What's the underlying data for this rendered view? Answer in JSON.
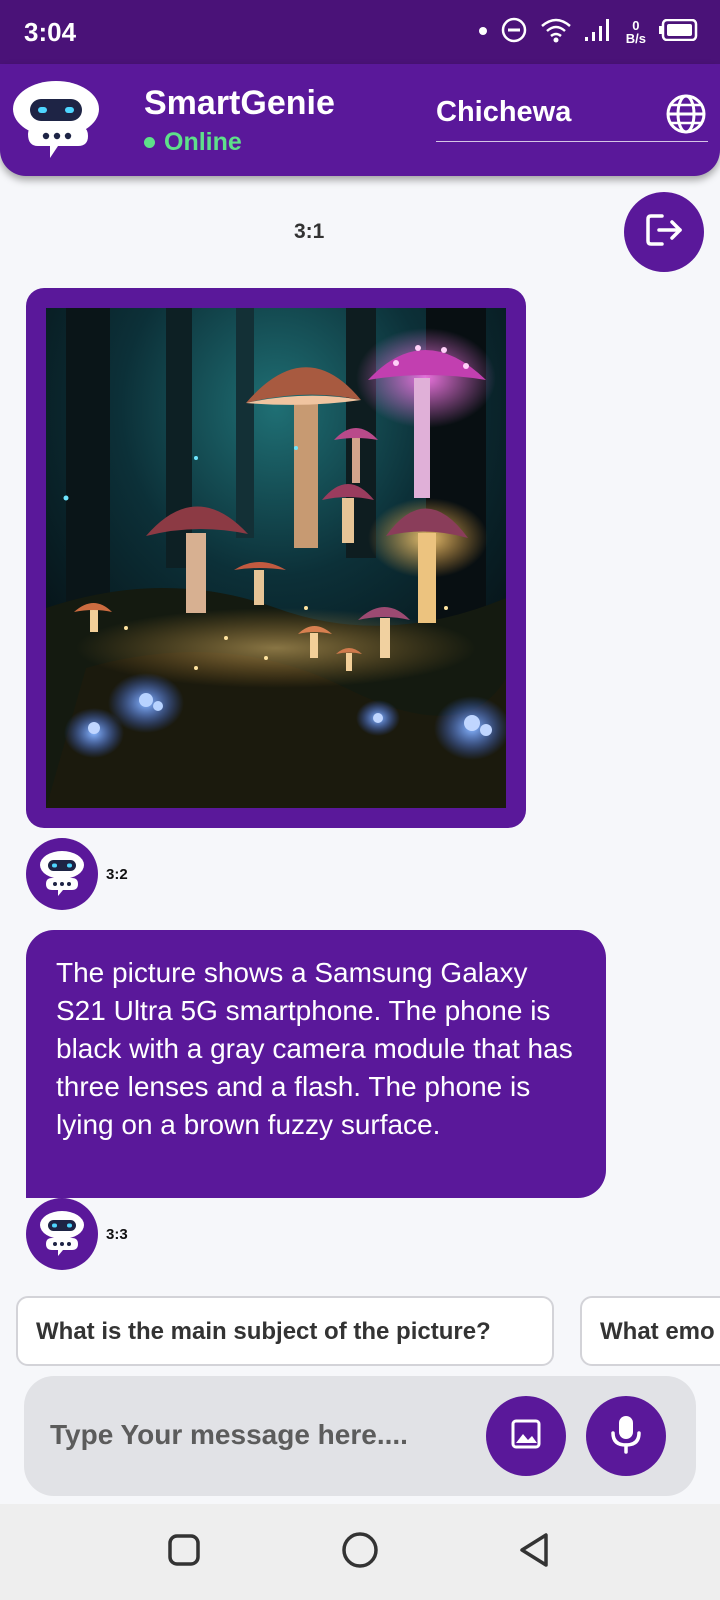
{
  "status_bar": {
    "time": "3:04",
    "net_speed_value": "0",
    "net_speed_unit": "B/s",
    "icons": [
      "dot-icon",
      "do-not-disturb-icon",
      "wifi-icon",
      "signal-icon",
      "battery-icon"
    ]
  },
  "header": {
    "title": "SmartGenie",
    "status": "Online",
    "language": "Chichewa",
    "icons": [
      "robot-logo-icon",
      "globe-icon"
    ]
  },
  "chat": {
    "top_timestamp": "3:1",
    "messages": [
      {
        "type": "image",
        "content": "fantasy forest with glowing mushrooms",
        "time": "3:2"
      },
      {
        "type": "text",
        "content": "The picture shows a Samsung Galaxy S21 Ultra 5G smartphone. The phone is black with a gray camera module that has three lenses and a flash. The phone is lying on a brown fuzzy surface.",
        "time": "3:3"
      }
    ],
    "logout_icon": "logout-icon"
  },
  "suggestions": [
    "What is the main subject of the picture?",
    "What emo"
  ],
  "input": {
    "placeholder": "Type Your message here....",
    "icons": [
      "image-icon",
      "microphone-icon"
    ]
  },
  "nav_bar": {
    "icons": [
      "recent-apps-icon",
      "home-icon",
      "back-icon"
    ]
  },
  "colors": {
    "primary": "#5a189a",
    "status_bar": "#4a1278",
    "online": "#5ee08a",
    "background": "#f6f7fa"
  }
}
